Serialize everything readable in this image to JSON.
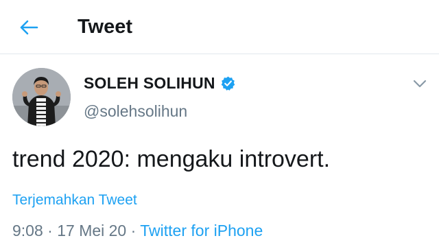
{
  "header": {
    "title": "Tweet",
    "back_icon": "arrow-left-icon"
  },
  "tweet": {
    "author": {
      "display_name": "SOLEH SOLIHUN",
      "handle": "@solehsolihun",
      "verified": true
    },
    "text": "trend 2020: mengaku introvert.",
    "translate_label": "Terjemahkan Tweet",
    "time": "9:08",
    "separator": "·",
    "date": "17 Mei 20",
    "source": "Twitter for iPhone"
  },
  "colors": {
    "accent": "#1da1f2",
    "muted": "#657786",
    "text": "#14171a",
    "divider": "#e1e8ed"
  }
}
